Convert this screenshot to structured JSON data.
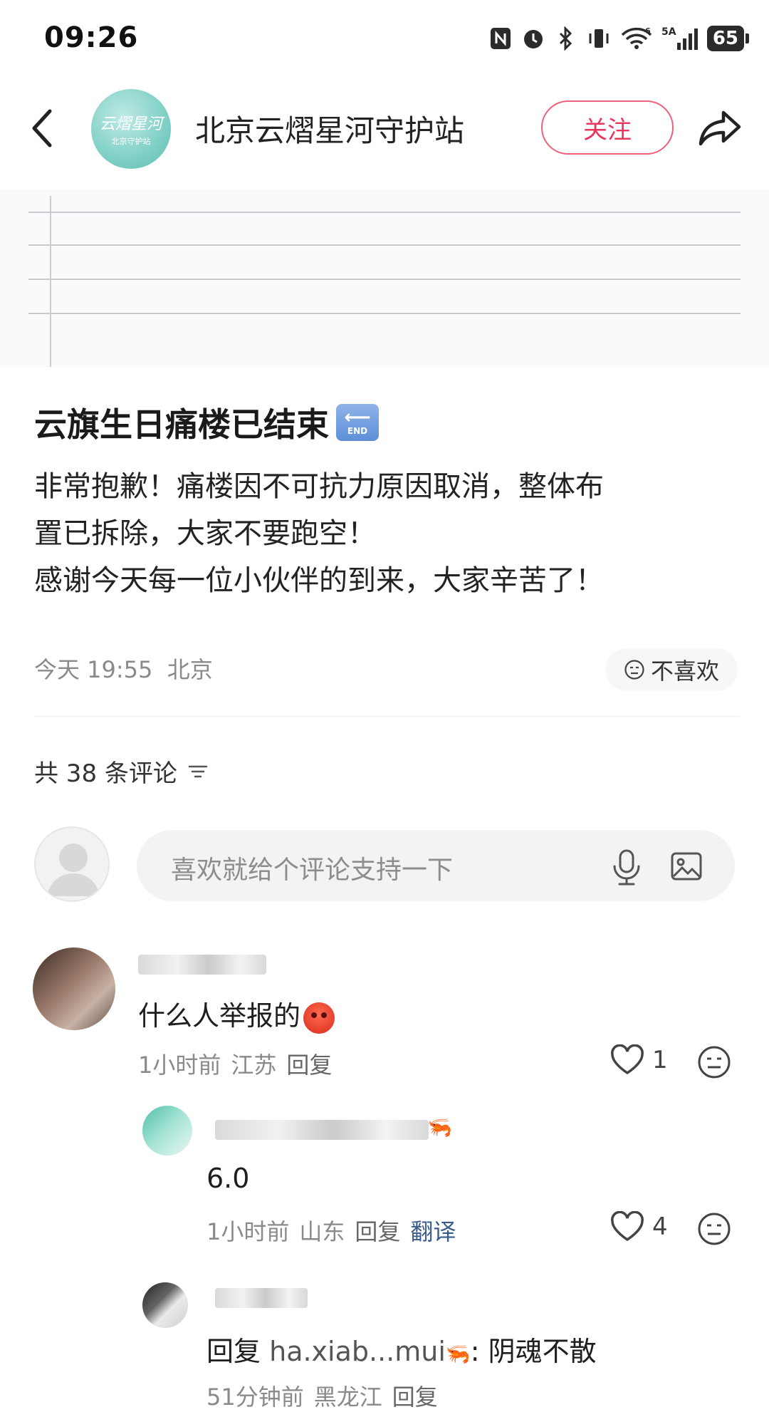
{
  "status_bar": {
    "time": "09:26",
    "network_label": "5A",
    "wifi_label": "6",
    "battery": "65"
  },
  "header": {
    "account_name": "北京云熠星河守护站",
    "avatar_logo_text": "云熠星河",
    "avatar_logo_sub": "北京守护站",
    "follow_label": "关注"
  },
  "post": {
    "title": "云旗生日痛楼已结束",
    "end_emoji_text": "END",
    "body_lines": [
      "非常抱歉！痛楼因不可抗力原因取消，整体布",
      "置已拆除，大家不要跑空！",
      "感谢今天每一位小伙伴的到来，大家辛苦了！"
    ],
    "meta": "今天 19:55  北京",
    "dislike_label": "不喜欢"
  },
  "comments_section": {
    "count_label": "共 38 条评论",
    "input_placeholder": "喜欢就给个评论支持一下"
  },
  "comments": [
    {
      "text": "什么人举报的",
      "time": "1小时前",
      "location": "江苏",
      "reply_label": "回复",
      "likes": "1"
    },
    {
      "text": "6.0",
      "time": "1小时前",
      "location": "山东",
      "reply_label": "回复",
      "translate_label": "翻译",
      "likes": "4"
    },
    {
      "reply_prefix": "回复",
      "reply_to": "ha.xiab...mui",
      "text": ": 阴魂不散",
      "time": "51分钟前",
      "location": "黑龙江",
      "reply_label": "回复"
    }
  ],
  "colors": {
    "accent": "#e8365d",
    "translate": "#3a5b8c",
    "meta_gray": "#8a8a8a",
    "logo_teal": "#7fd0c6"
  }
}
